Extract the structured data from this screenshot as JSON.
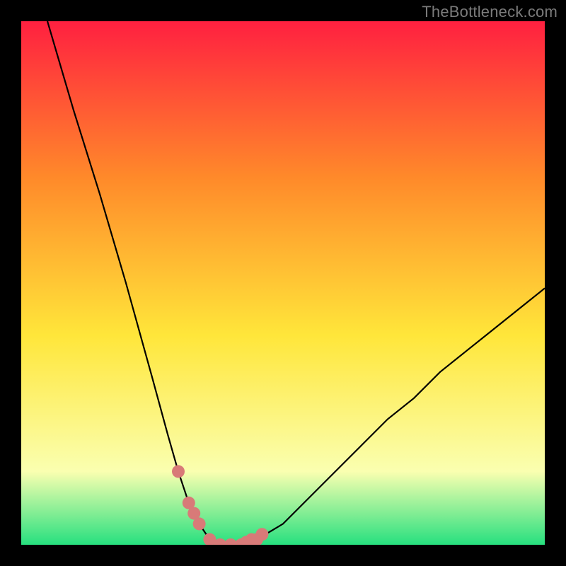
{
  "watermark": "TheBottleneck.com",
  "colors": {
    "background_black": "#000000",
    "gradient_top": "#ff2040",
    "gradient_mid1": "#ff8a2a",
    "gradient_mid2": "#ffe63a",
    "gradient_low": "#faffb0",
    "gradient_bottom": "#27e07f",
    "curve_stroke": "#000000",
    "marker_stroke": "#d87a78",
    "watermark_text": "#7b7b7b"
  },
  "chart_data": {
    "type": "line",
    "title": "",
    "xlabel": "",
    "ylabel": "",
    "xlim": [
      0,
      100
    ],
    "ylim": [
      0,
      100
    ],
    "grid": false,
    "legend": false,
    "annotations": [],
    "series": [
      {
        "name": "bottleneck-curve",
        "x": [
          5,
          10,
          15,
          20,
          25,
          28,
          30,
          32,
          34,
          36,
          38,
          40,
          42,
          45,
          50,
          55,
          60,
          65,
          70,
          75,
          80,
          85,
          90,
          95,
          100
        ],
        "y": [
          100,
          83,
          67,
          50,
          32,
          21,
          14,
          8,
          4,
          1,
          0,
          0,
          0,
          1,
          4,
          9,
          14,
          19,
          24,
          28,
          33,
          37,
          41,
          45,
          49
        ]
      }
    ],
    "markers": {
      "name": "near-zero-band",
      "x": [
        30,
        32,
        33,
        34,
        36,
        38,
        40,
        42,
        43,
        44,
        45,
        46
      ],
      "y": [
        14,
        8,
        6,
        4,
        1,
        0,
        0,
        0,
        0.5,
        1,
        1,
        2
      ]
    }
  }
}
